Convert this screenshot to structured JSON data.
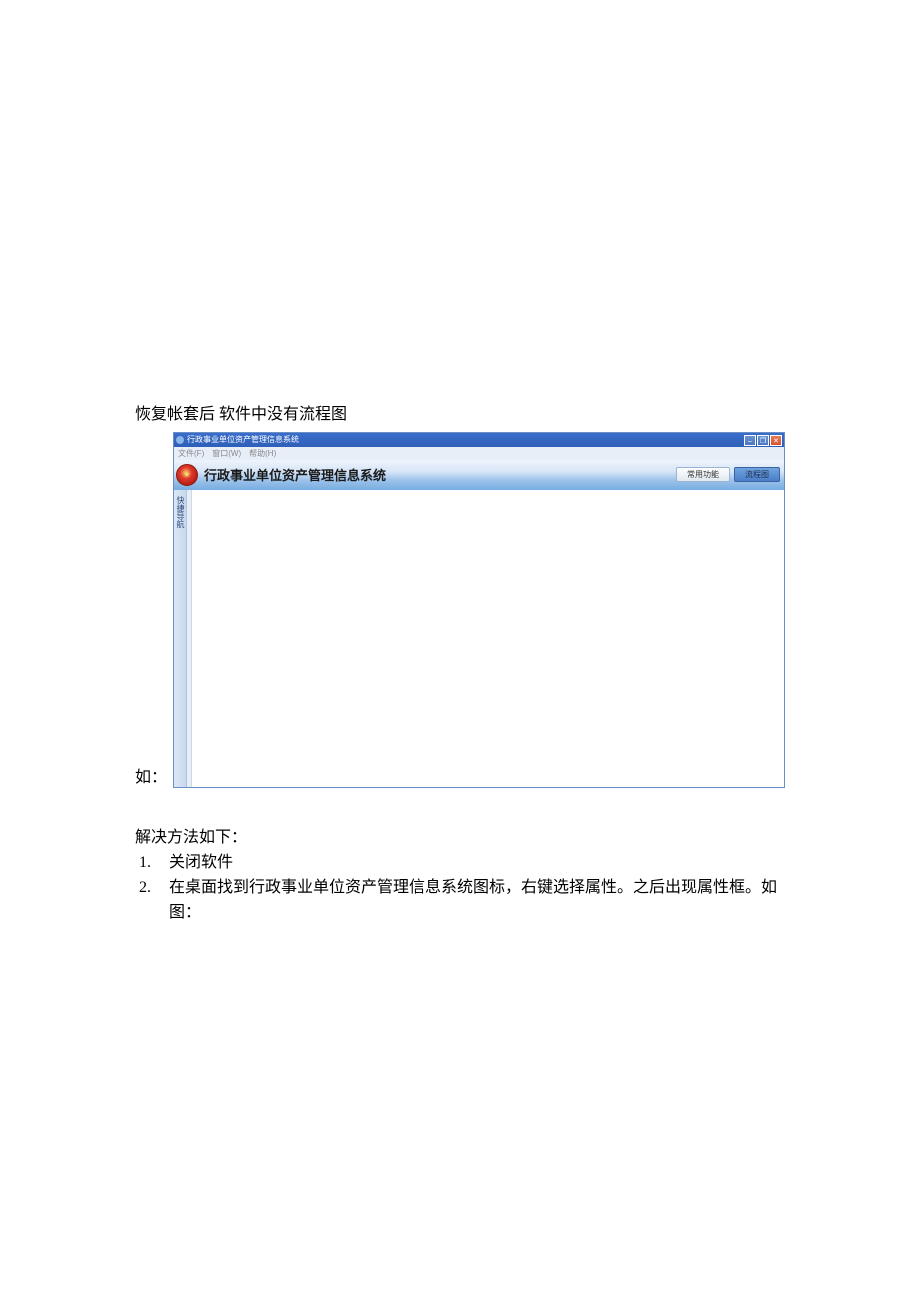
{
  "document": {
    "heading": "恢复帐套后  软件中没有流程图",
    "label_as": "如：",
    "solution_heading": "解决方法如下：",
    "solution_items": [
      "关闭软件",
      "在桌面找到行政事业单位资产管理信息系统图标，右键选择属性。之后出现属性框。如图："
    ]
  },
  "app_window": {
    "titlebar_title": "行政事业单位资产管理信息系统",
    "menubar": [
      "文件(F)",
      "窗口(W)",
      "帮助(H)"
    ],
    "app_title": "行政事业单位资产管理信息系统",
    "tabs": {
      "common": "常用功能",
      "flowchart": "流程图"
    },
    "sidebar_label": "快捷导航",
    "win_controls": {
      "minimize": "–",
      "maximize": "❐",
      "close": "✕"
    }
  }
}
